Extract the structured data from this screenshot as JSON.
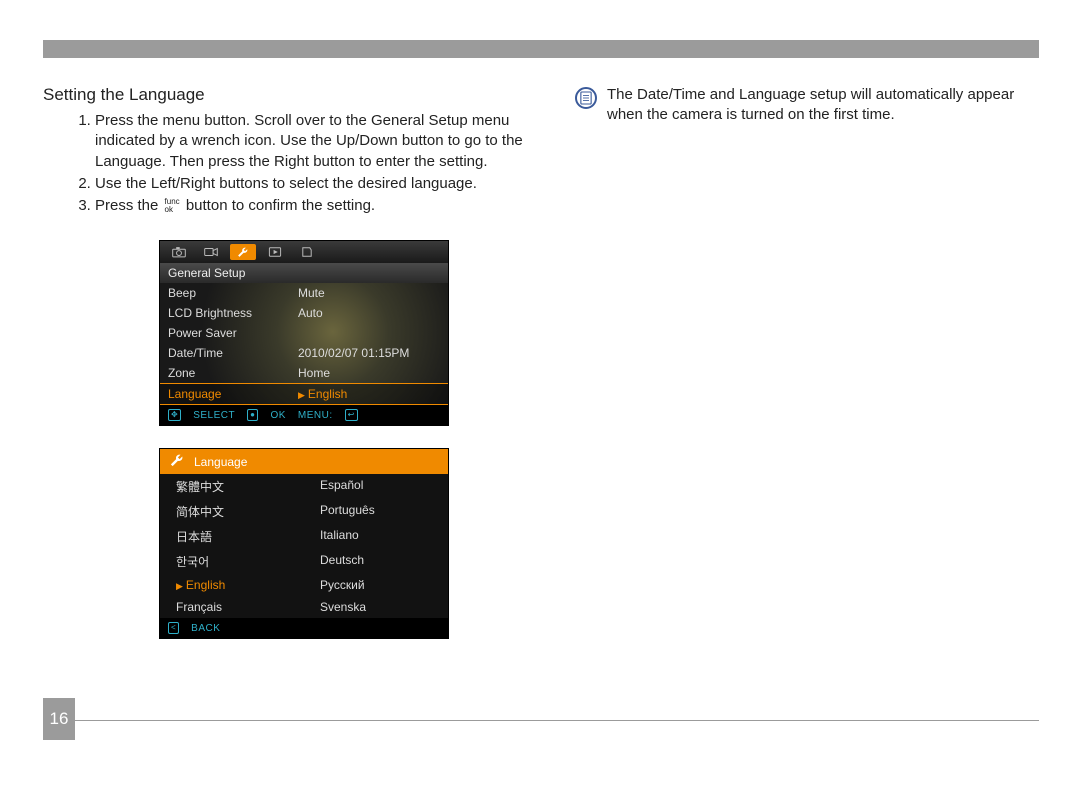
{
  "page_number": "16",
  "section_title": "Setting the Language",
  "steps": [
    "Press the menu button.  Scroll over to the General Setup menu indicated by a wrench icon. Use the Up/Down button to go to the Language. Then press the Right button to enter the setting.",
    "Use the Left/Right buttons to select the desired language.",
    "Press the  button to confirm the setting."
  ],
  "func_ok": {
    "top": "func",
    "bottom": "ok"
  },
  "note": "The Date/Time and Language setup will automatically appear when the camera is turned on the first time.",
  "shot1": {
    "header": "General Setup",
    "rows": [
      {
        "label": "Beep",
        "value": "Mute"
      },
      {
        "label": "LCD Brightness",
        "value": "Auto"
      },
      {
        "label": "Power Saver",
        "value": ""
      },
      {
        "label": "Date/Time",
        "value": "2010/02/07  01:15PM"
      },
      {
        "label": "Zone",
        "value": "Home"
      },
      {
        "label": "Language",
        "value": "English",
        "selected": true,
        "arrow": true
      }
    ],
    "footer": {
      "select": "SELECT",
      "ok": "OK",
      "menu": "MENU:"
    }
  },
  "shot2": {
    "header": "Language",
    "left": [
      "繁體中文",
      "简体中文",
      "日本語",
      "한국어",
      "English",
      "Français"
    ],
    "right": [
      "Español",
      "Português",
      "Italiano",
      "Deutsch",
      "Русский",
      "Svenska"
    ],
    "selected": "English",
    "footer_back": "BACK"
  }
}
